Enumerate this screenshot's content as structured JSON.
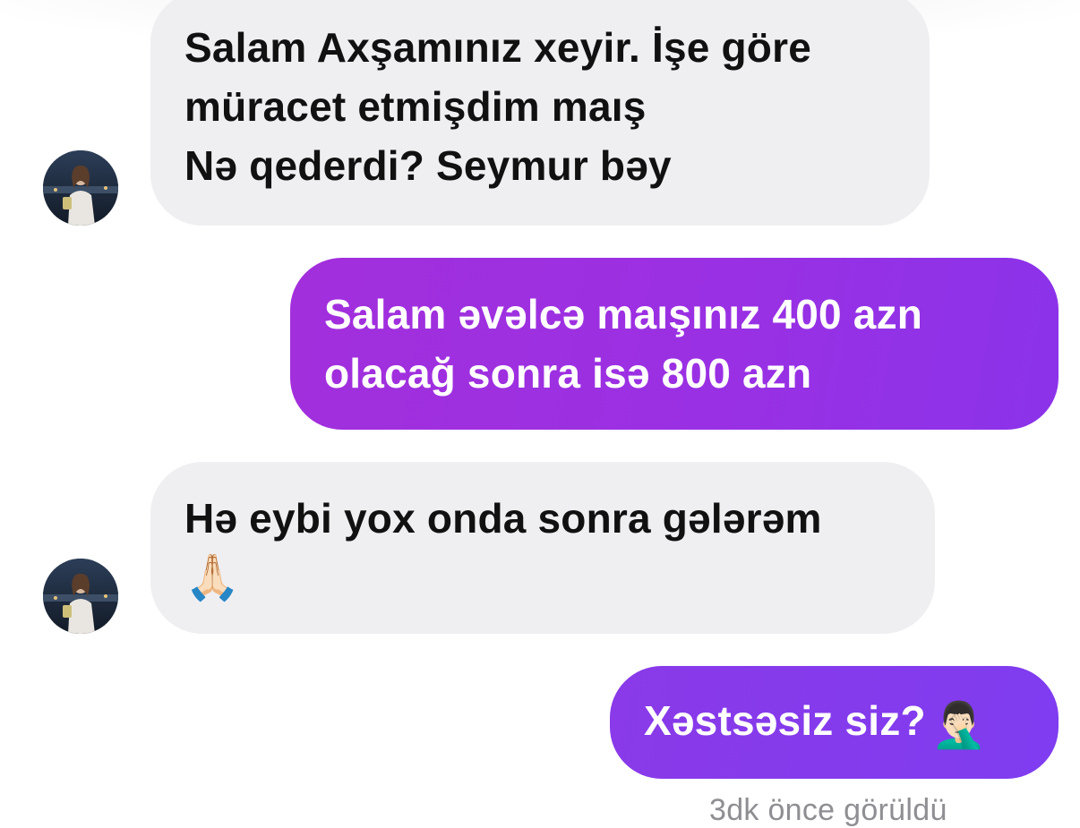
{
  "conversation": {
    "messages": [
      {
        "direction": "incoming",
        "lines": [
          "Salam Axşamınız xeyir. İşe göre",
          "müracet etmişdim maış",
          "Nə qederdi? Seymur bəy"
        ]
      },
      {
        "direction": "outgoing",
        "lines": [
          "Salam əvəlcə maışınız 400 azn",
          "olacağ sonra isə 800 azn"
        ]
      },
      {
        "direction": "incoming",
        "lines": [
          "Hə eybi yox onda sonra gələrəm"
        ],
        "emoji": "🙏🏻"
      },
      {
        "direction": "outgoing",
        "text": "Xəstsəsiz siz?",
        "emoji": "🤦🏻‍♂️"
      }
    ],
    "seen_status": "3dk önce görüldü"
  },
  "colors": {
    "incoming_bubble": "#efeff2",
    "incoming_text": "#111111",
    "outgoing_gradient_start": "#a22fdc",
    "outgoing_gradient_end": "#7f3cf0",
    "outgoing_text": "#ffffff",
    "seen_text": "#8e8e93"
  },
  "icons": {
    "contact_avatar": "profile-photo-avatar"
  }
}
